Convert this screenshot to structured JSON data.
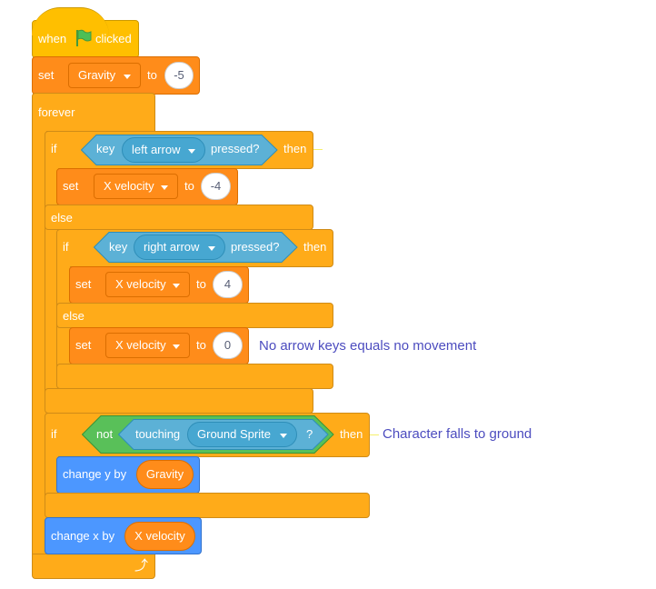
{
  "colors": {
    "events": "#ffbf00",
    "variables": "#ff8c1a",
    "control": "#ffab19",
    "sensing": "#5cb1d6",
    "operators": "#59c059",
    "motion": "#4c97ff",
    "comment": "#4c4cbf"
  },
  "hat": {
    "when": "when",
    "icon": "green-flag-icon",
    "clicked": "clicked"
  },
  "set_gravity": {
    "set": "set",
    "var": "Gravity",
    "to": "to",
    "value": "-5"
  },
  "forever": {
    "label": "forever",
    "icon": "loop-arrow-icon"
  },
  "if1": {
    "if": "if",
    "key": "key",
    "option": "left arrow",
    "pressed": "pressed?",
    "then": "then",
    "else": "else",
    "set": {
      "set": "set",
      "var": "X velocity",
      "to": "to",
      "value": "-4"
    }
  },
  "if2": {
    "if": "if",
    "key": "key",
    "option": "right arrow",
    "pressed": "pressed?",
    "then": "then",
    "else": "else",
    "set_then": {
      "set": "set",
      "var": "X velocity",
      "to": "to",
      "value": "4"
    },
    "set_else": {
      "set": "set",
      "var": "X velocity",
      "to": "to",
      "value": "0"
    },
    "comment": "No arrow keys equals no movement"
  },
  "if3": {
    "if": "if",
    "not": "not",
    "touching": "touching",
    "option": "Ground Sprite",
    "q": "?",
    "then": "then",
    "comment": "Character falls to ground",
    "change_y": {
      "label": "change y by",
      "var": "Gravity"
    }
  },
  "change_x": {
    "label": "change x by",
    "var": "X velocity"
  }
}
